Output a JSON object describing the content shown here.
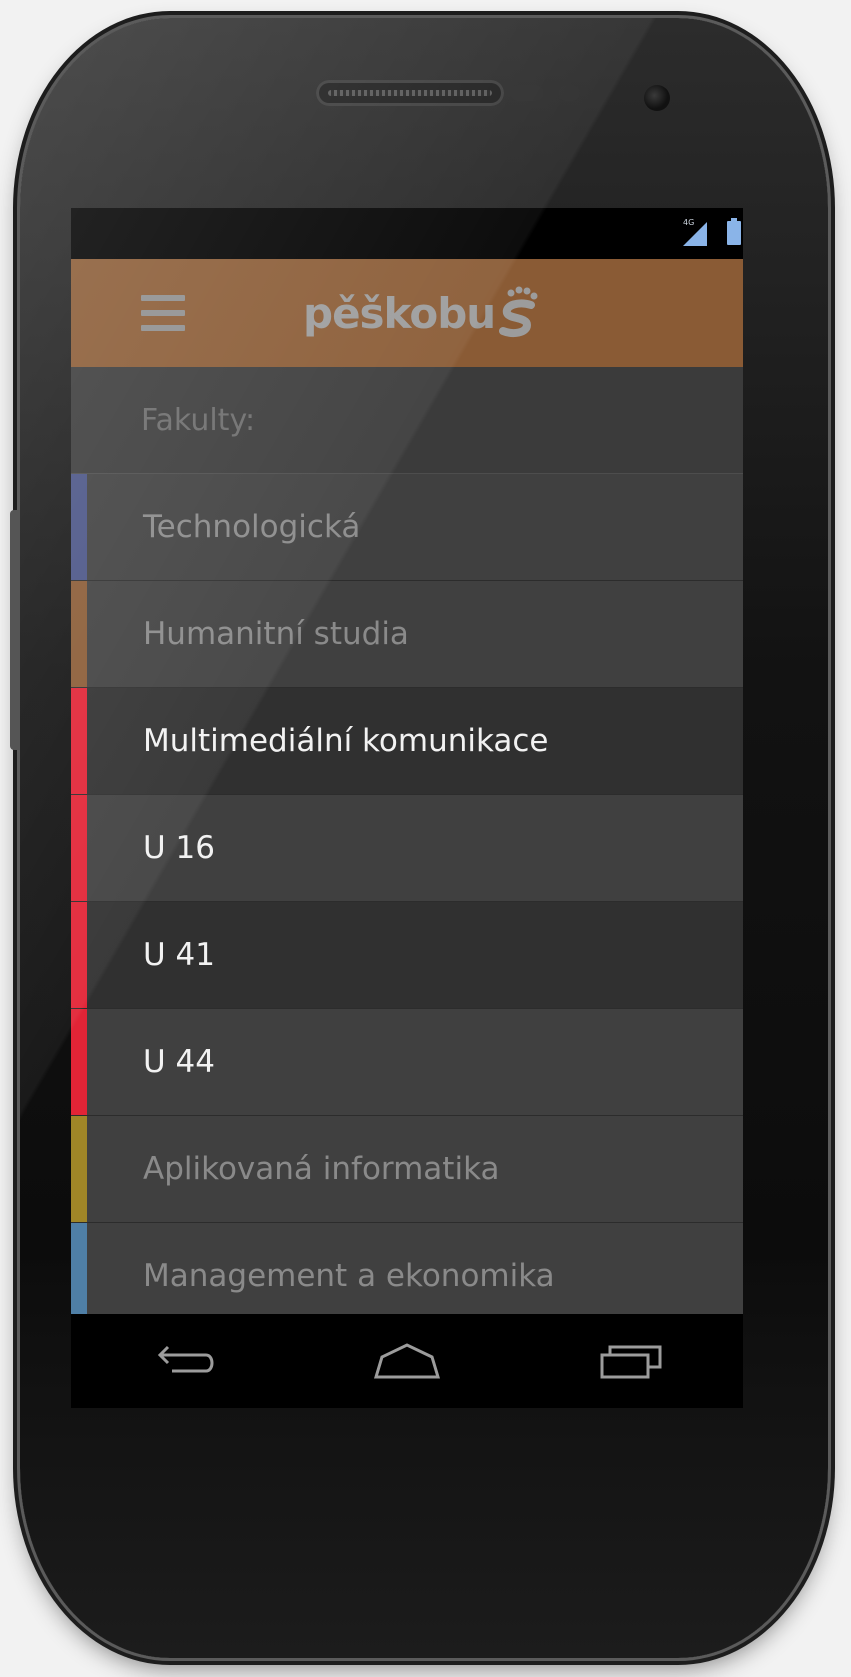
{
  "status_bar": {
    "network_label": "4G"
  },
  "app": {
    "logo_text": "pěškobu"
  },
  "list": {
    "header": "Fakulty:",
    "items": [
      {
        "label": "Technologická",
        "color": "#4a5486",
        "selected": false,
        "shade": "mid"
      },
      {
        "label": "Humanitní studia",
        "color": "#8a5b35",
        "selected": false,
        "shade": "mid"
      },
      {
        "label": "Multimediální komunikace",
        "color": "#e22436",
        "selected": true,
        "shade": "dark"
      },
      {
        "label": "U 16",
        "color": "#e22436",
        "selected": true,
        "shade": "mid"
      },
      {
        "label": "U 41",
        "color": "#e22436",
        "selected": true,
        "shade": "dark"
      },
      {
        "label": "U 44",
        "color": "#e22436",
        "selected": true,
        "shade": "mid"
      },
      {
        "label": "Aplikovaná informatika",
        "color": "#a08627",
        "selected": false,
        "shade": "mid"
      },
      {
        "label": "Management a ekonomika",
        "color": "#4f7fa6",
        "selected": false,
        "shade": "mid"
      }
    ]
  },
  "colors": {
    "app_bar": "#8a5b35",
    "list_bg": "#404040"
  },
  "nav": {
    "icons": [
      "back-icon",
      "home-icon",
      "recent-apps-icon"
    ]
  }
}
